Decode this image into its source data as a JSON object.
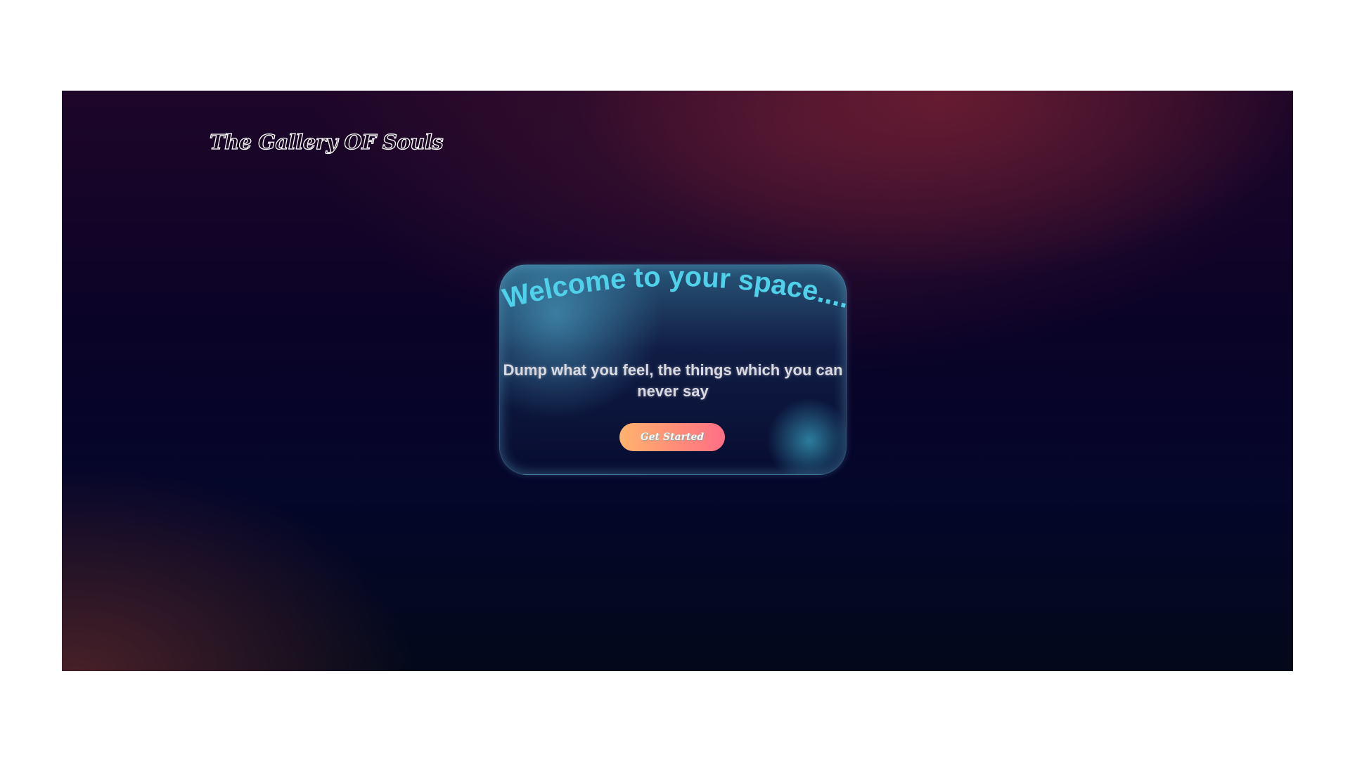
{
  "header": {
    "logo_text": "The Gallery OF Souls"
  },
  "hero": {
    "title": "Welcome to your space....",
    "subtitle_line1": "Dump what you feel, the things which you can",
    "subtitle_line2": "never say",
    "cta_label": "Get Started"
  },
  "colors": {
    "title": "#4fd1ea",
    "button_start": "#ffb36e",
    "button_end": "#ff6f86",
    "background": "#04062a"
  }
}
